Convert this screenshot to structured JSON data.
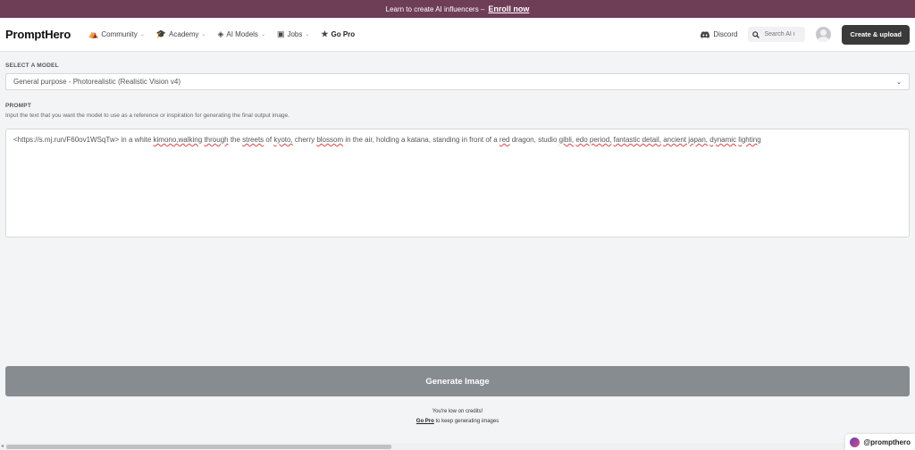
{
  "banner": {
    "text": "Learn to create AI influencers –",
    "link": "Enroll now"
  },
  "nav": {
    "logo": "PromptHero",
    "items": [
      {
        "label": "Community",
        "icon": "community-icon",
        "dropdown": true
      },
      {
        "label": "Academy",
        "icon": "academy-icon",
        "dropdown": true
      },
      {
        "label": "AI Models",
        "icon": "cube-icon",
        "dropdown": true
      },
      {
        "label": "Jobs",
        "icon": "briefcase-icon",
        "dropdown": true
      },
      {
        "label": "Go Pro",
        "icon": "star-icon",
        "dropdown": false
      }
    ],
    "discord": "Discord",
    "search_placeholder": "Search AI i",
    "create_button": "Create & upload"
  },
  "form": {
    "model_label": "SELECT A MODEL",
    "model_value": "General purpose - Photorealistic (Realistic Vision v4)",
    "prompt_label": "PROMPT",
    "prompt_helper": "Input the text that you want the model to use as a reference or inspiration for generating the final output image.",
    "prompt_segments": [
      {
        "t": "<https://s.mj.run/F60ov1WSqTw> in a white ",
        "s": false
      },
      {
        "t": "kimono,walking",
        "s": true
      },
      {
        "t": " ",
        "s": false
      },
      {
        "t": "through",
        "s": true
      },
      {
        "t": " the ",
        "s": false
      },
      {
        "t": "streets",
        "s": true
      },
      {
        "t": " of ",
        "s": false
      },
      {
        "t": "kyoto,",
        "s": true
      },
      {
        "t": " cherry ",
        "s": false
      },
      {
        "t": "blossom",
        "s": true
      },
      {
        "t": " in the air, holding a katana, standing in front of a ",
        "s": false
      },
      {
        "t": "red",
        "s": true
      },
      {
        "t": " dragon, studio ",
        "s": false
      },
      {
        "t": "gibli,",
        "s": true
      },
      {
        "t": " ",
        "s": false
      },
      {
        "t": "edo period,",
        "s": true
      },
      {
        "t": " ",
        "s": false
      },
      {
        "t": "fantastic detail,",
        "s": true
      },
      {
        "t": " ",
        "s": false
      },
      {
        "t": "ancient japan,",
        "s": true
      },
      {
        "t": " ",
        "s": false
      },
      {
        "t": "dynamic",
        "s": true
      },
      {
        "t": " ",
        "s": false
      },
      {
        "t": "lighting",
        "s": true
      }
    ],
    "generate_button": "Generate Image",
    "credits_msg": "You're low on credits!",
    "credits_link": "Go Pro",
    "credits_suffix": "to keep generating images"
  },
  "badge": {
    "user": "@prompthero"
  }
}
